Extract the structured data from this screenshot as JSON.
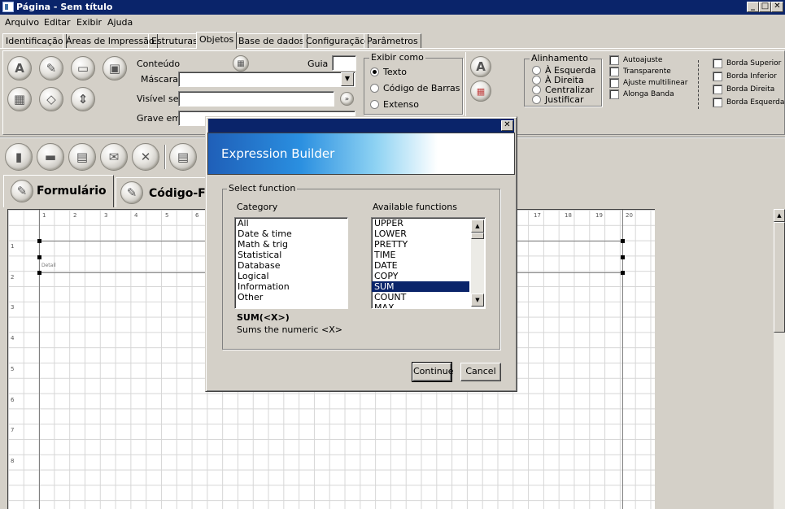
{
  "window": {
    "title": "Página - Sem título"
  },
  "menu": [
    "Arquivo",
    "Editar",
    "Exibir",
    "Ajuda"
  ],
  "tabs": [
    "Identificação",
    "Áreas de Impressão",
    "Estruturas",
    "Objetos",
    "Base de dados",
    "Configuração",
    "Parâmetros"
  ],
  "active_tab": "Objetos",
  "objects_panel": {
    "conteudo_label": "Conteúdo",
    "guia_label": "Guia",
    "mascara_label": "Máscara",
    "visivel_label": "Visível se",
    "grave_label": "Grave em",
    "exibir_como": {
      "legend": "Exibir como",
      "options": [
        "Texto",
        "Código de Barras",
        "Extenso"
      ],
      "selected": "Texto"
    },
    "alinhamento": {
      "legend": "Alinhamento",
      "options": [
        "À Esquerda",
        "À Direita",
        "Centralizar",
        "Justificar"
      ]
    },
    "checks": [
      "Autoajuste",
      "Transparente",
      "Ajuste multilinear",
      "Alonga Banda"
    ],
    "borders": [
      "Borda Superior",
      "Borda Inferior",
      "Borda Direita",
      "Borda Esquerda"
    ]
  },
  "editor_tabs": [
    "Formulário",
    "Código-F"
  ],
  "ruler": {
    "top": [
      "1",
      "2",
      "3",
      "4",
      "5",
      "6",
      "17",
      "18",
      "19",
      "20"
    ],
    "left": [
      "1",
      "2",
      "3",
      "4",
      "5",
      "6",
      "7",
      "8"
    ]
  },
  "band_label": "Detail",
  "dialog": {
    "title": "Expression Builder",
    "group_label": "Select function",
    "category_label": "Category",
    "categories": [
      "All",
      "Date & time",
      "Math & trig",
      "Statistical",
      "Database",
      "Logical",
      "Information",
      "Other"
    ],
    "functions_label": "Available functions",
    "functions": [
      "UPPER",
      "LOWER",
      "PRETTY",
      "TIME",
      "DATE",
      "COPY",
      "SUM",
      "COUNT",
      "MAX"
    ],
    "selected_function": "SUM",
    "signature": "SUM(<X>)",
    "description": "Sums the numeric <X>",
    "continue_label": "Continue",
    "cancel_label": "Cancel",
    "close_glyph": "✕"
  },
  "colors": {
    "titlebar": "#0a246a",
    "face": "#d4d0c8",
    "selection": "#0a246a"
  }
}
